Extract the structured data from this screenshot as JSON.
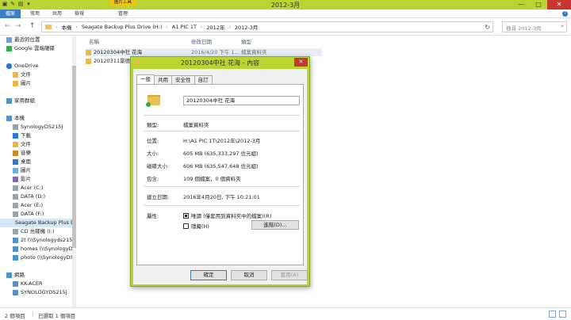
{
  "window": {
    "title": "2012-3月",
    "context_tab": "圖片工具",
    "controls": {
      "minimize": "—",
      "maximize": "□",
      "close": "✕"
    }
  },
  "ribbon": {
    "tabs": [
      "檔案",
      "常用",
      "共用",
      "檢視",
      "管理"
    ],
    "help": "?"
  },
  "address": {
    "back": "←",
    "forward": "→",
    "up": "↑",
    "crumbs": [
      "本機",
      "Seagate Backup Plus Drive (H:)",
      "A1 PIC 1T",
      "2012年",
      "2012-3月"
    ],
    "search_placeholder": "搜尋 2012-3月"
  },
  "nav": {
    "items": [
      {
        "label": "最近的位置",
        "icon": "recent-places-icon"
      },
      {
        "label": "Google 雲端硬碟",
        "icon": "google-drive-icon"
      },
      {
        "label": "OneDrive",
        "icon": "onedrive-icon"
      },
      {
        "label": "文件",
        "icon": "folder-icon"
      },
      {
        "label": "圖片",
        "icon": "folder-icon"
      },
      {
        "label": "家用群組",
        "icon": "homegroup-icon"
      },
      {
        "label": "本機",
        "icon": "this-pc-icon"
      },
      {
        "label": "SynologyDS215J",
        "icon": "nas-icon"
      },
      {
        "label": "下載",
        "icon": "downloads-icon"
      },
      {
        "label": "文件",
        "icon": "documents-icon"
      },
      {
        "label": "音樂",
        "icon": "music-icon"
      },
      {
        "label": "桌面",
        "icon": "desktop-icon"
      },
      {
        "label": "圖片",
        "icon": "pictures-icon"
      },
      {
        "label": "影片",
        "icon": "videos-icon"
      },
      {
        "label": "Acer (C:)",
        "icon": "drive-icon"
      },
      {
        "label": "DATA (D:)",
        "icon": "drive-icon"
      },
      {
        "label": "Acer (E:)",
        "icon": "drive-icon"
      },
      {
        "label": "DATA (F:)",
        "icon": "drive-icon"
      },
      {
        "label": "Seagate Backup Plus D",
        "icon": "drive-icon"
      },
      {
        "label": "CD 光碟機 (I:)",
        "icon": "cd-drive-icon"
      },
      {
        "label": "2t (\\\\Synologyds215j)",
        "icon": "network-drive-icon"
      },
      {
        "label": "homes (\\\\SynologyDS",
        "icon": "network-drive-icon"
      },
      {
        "label": "photo (\\\\SynologyDS",
        "icon": "network-drive-icon"
      },
      {
        "label": "網路",
        "icon": "network-icon"
      },
      {
        "label": "KK-ACER",
        "icon": "computer-icon"
      },
      {
        "label": "SYNOLOGYDS215J",
        "icon": "computer-icon"
      }
    ]
  },
  "files": {
    "columns": [
      "名稱",
      "修改日期",
      "類型"
    ],
    "rows": [
      {
        "name": "20120304中社 花海",
        "date": "2016/4/20 下午 1...",
        "type": "檔案資料夾"
      },
      {
        "name": "20120311景德",
        "date": "",
        "type": ""
      }
    ]
  },
  "status": {
    "count": "2 個項目",
    "selected": "已選取 1 個項目"
  },
  "dialog": {
    "title": "20120304中社 花海 - 內容",
    "close": "✕",
    "tabs": [
      "一般",
      "共用",
      "安全性",
      "自訂"
    ],
    "name": "20120304中社 花海",
    "props": {
      "type_label": "類型:",
      "type_value": "檔案資料夾",
      "location_label": "位置:",
      "location_value": "H:\\A1 PIC 1T\\2012年\\2012-3月",
      "size_label": "大小:",
      "size_value": "605 MB (635,333,297 位元組)",
      "disk_label": "磁碟大小:",
      "disk_value": "606 MB (635,547,648 位元組)",
      "contains_label": "包含:",
      "contains_value": "109 個檔案，0 個資料夾",
      "created_label": "建立日期:",
      "created_value": "2016年4月20日, 下午 10:21:01",
      "attr_label": "屬性:",
      "readonly_label": "唯讀 (僅套用到資料夾中的檔案)(R)",
      "hidden_label": "隱藏(H)",
      "advanced_label": "進階(D)..."
    },
    "buttons": {
      "ok": "確定",
      "cancel": "取消",
      "apply": "套用(A)"
    }
  }
}
